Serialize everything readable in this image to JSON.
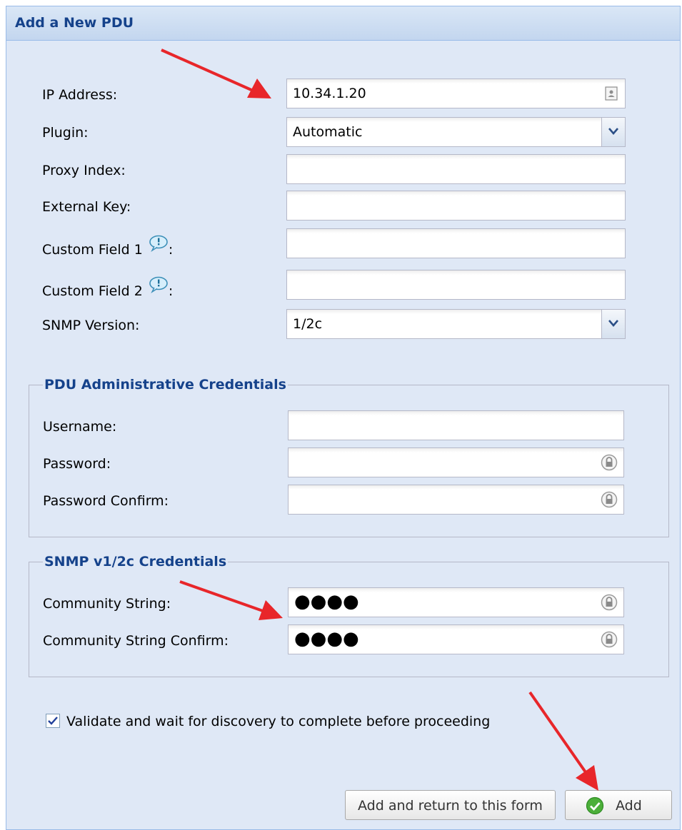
{
  "panel": {
    "title": "Add a New PDU"
  },
  "form": {
    "ip_address": {
      "label": "IP Address:",
      "value": "10.34.1.20"
    },
    "plugin": {
      "label": "Plugin:",
      "value": "Automatic"
    },
    "proxy_index": {
      "label": "Proxy Index:",
      "value": ""
    },
    "external_key": {
      "label": "External Key:",
      "value": ""
    },
    "custom_field_1": {
      "label": "Custom Field 1",
      "suffix": ":",
      "value": ""
    },
    "custom_field_2": {
      "label": "Custom Field 2",
      "suffix": ":",
      "value": ""
    },
    "snmp_version": {
      "label": "SNMP Version:",
      "value": "1/2c"
    }
  },
  "admin_credentials": {
    "legend": "PDU Administrative Credentials",
    "username": {
      "label": "Username:",
      "value": ""
    },
    "password": {
      "label": "Password:",
      "value": ""
    },
    "password_confirm": {
      "label": "Password Confirm:",
      "value": ""
    }
  },
  "snmp_credentials": {
    "legend": "SNMP v1/2c Credentials",
    "community_string": {
      "label": "Community String:",
      "masked_value": "●●●●"
    },
    "community_string_confirm": {
      "label": "Community String Confirm:",
      "masked_value": "●●●●"
    }
  },
  "validate": {
    "checked": true,
    "label": "Validate and wait for discovery to complete before proceeding"
  },
  "buttons": {
    "add_and_return": "Add and return to this form",
    "add": "Add"
  },
  "icons": {
    "dropdown": "chevron-down-icon",
    "ip_field": "address-book-icon",
    "tooltip": "speech-bubble-icon",
    "password": "lock-icon",
    "add_button": "check-circle-icon",
    "annotation": "red-arrow-icon"
  },
  "colors": {
    "panel_background": "#dfe8f6",
    "title_text": "#15428b",
    "annotation_arrow": "#e8262a",
    "add_icon": "#3ea82c"
  }
}
